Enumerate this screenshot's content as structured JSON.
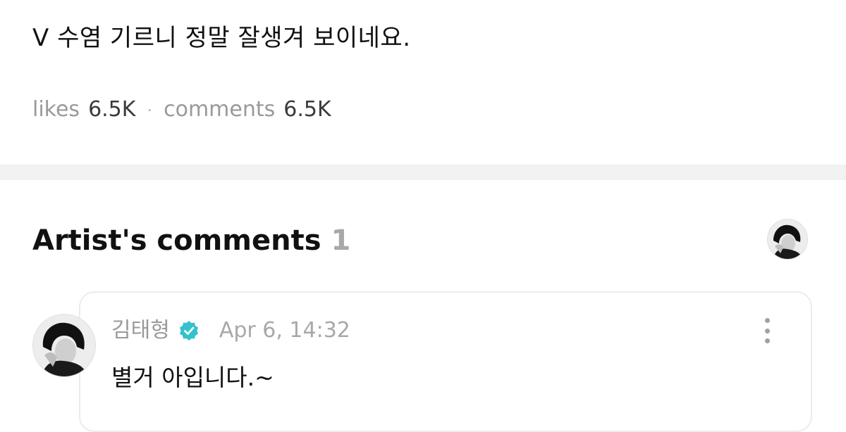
{
  "post": {
    "text": "V 수염 기르니 정말 잘생겨 보이네요."
  },
  "stats": {
    "likes_label": "likes",
    "likes_value": "6.5K",
    "separator": "·",
    "comments_label": "comments",
    "comments_value": "6.5K"
  },
  "artist_comments": {
    "title": "Artist's comments",
    "count": "1",
    "avatar_icon": "artist-avatar-icon"
  },
  "comment": {
    "author": "김태형",
    "verified_icon": "verified-badge-icon",
    "timestamp": "Apr 6, 14:32",
    "body": "별거 아입니다.~",
    "more_icon": "more-vertical-icon"
  },
  "colors": {
    "verified": "#33c2cc",
    "muted_text": "#9a9a9a",
    "divider": "#f2f2f2"
  }
}
